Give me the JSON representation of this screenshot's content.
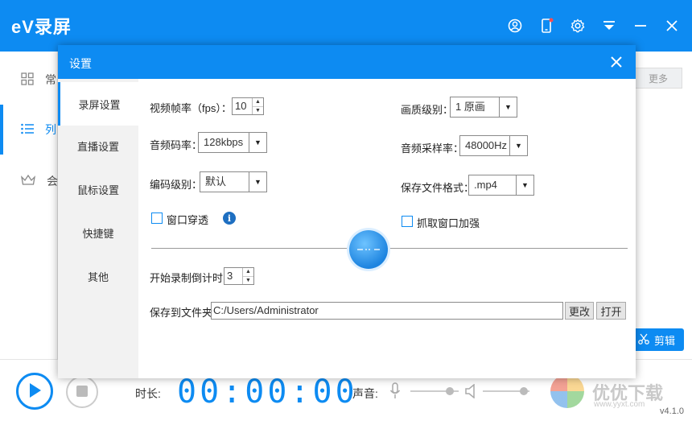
{
  "app": {
    "logo": "eV录屏",
    "sidebar": [
      "常",
      "列",
      "会"
    ],
    "more_label": "更多",
    "cut_label": "剪辑",
    "duration_label": "时长:",
    "timer": "00:00:00",
    "volume_label": "声音:",
    "version": "v4.1.0"
  },
  "watermark": {
    "text": "优优下载",
    "url": "www.yyxt.com"
  },
  "dialog": {
    "title": "设置",
    "nav": [
      "录屏设置",
      "直播设置",
      "鼠标设置",
      "快捷键",
      "其他"
    ],
    "active_nav": 0,
    "fps_label": "视频帧率（fps）：",
    "fps_value": "10",
    "quality_label": "画质级别：",
    "quality_value": "1 原画",
    "audio_bitrate_label": "音频码率：",
    "audio_bitrate_value": "128kbps",
    "sample_rate_label": "音频采样率：",
    "sample_rate_value": "48000Hz",
    "encode_label": "编码级别：",
    "encode_value": "默认",
    "format_label": "保存文件格式：",
    "format_value": ".mp4",
    "window_through_label": "窗口穿透",
    "window_through_checked": false,
    "capture_enhance_label": "抓取窗口加强",
    "capture_enhance_checked": false,
    "countdown_label": "开始录制倒计时：",
    "countdown_value": "3",
    "save_folder_label": "保存到文件夹：",
    "save_folder_value": "C:/Users/Administrator",
    "change_label": "更改",
    "open_label": "打开"
  },
  "colors": {
    "accent": "#0d8bf2"
  }
}
